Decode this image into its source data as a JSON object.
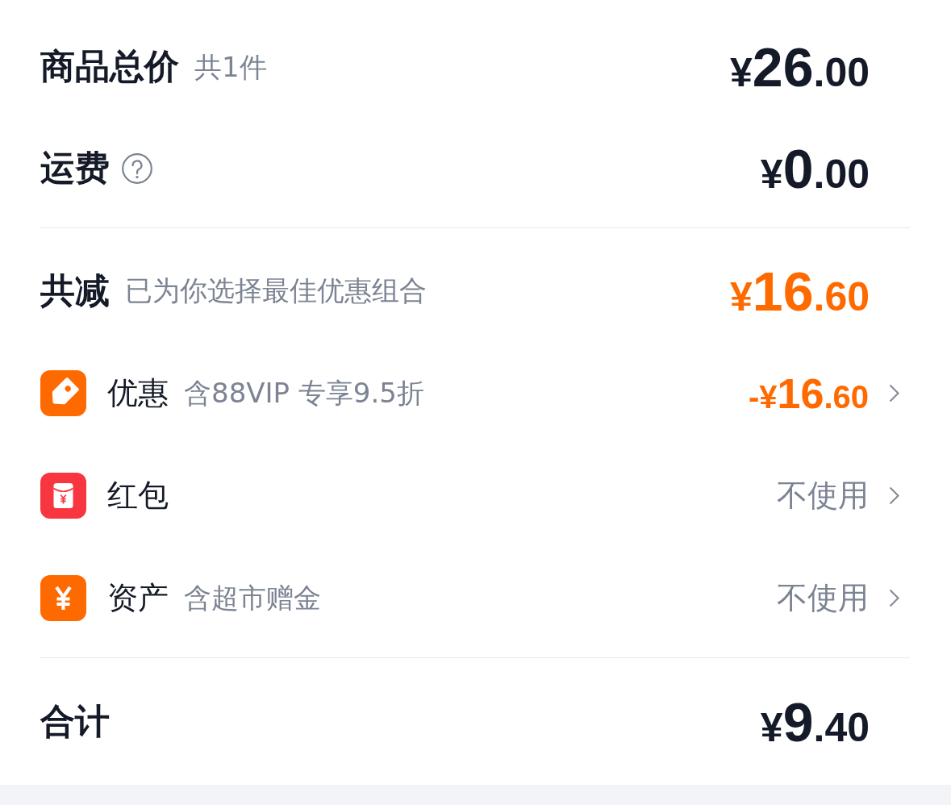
{
  "summary": [
    {
      "label": "商品总价",
      "note": "共1件",
      "help_icon": false,
      "amount": "¥26.00"
    },
    {
      "label": "运费",
      "help_icon": true,
      "amount": "¥0.00"
    }
  ],
  "discount_total": {
    "label": "共减",
    "note": "已为你选择最佳优惠组合",
    "amount": "¥16.60"
  },
  "discounts": [
    {
      "label": "优惠",
      "note": "含88VIP 专享9.5折",
      "kind": "amount",
      "value": "-¥16.60"
    },
    {
      "label": "红包",
      "kind": "option",
      "value": "不使用"
    },
    {
      "label": "资产",
      "note": "含超市赠金",
      "kind": "option",
      "value": "不使用"
    }
  ],
  "total": {
    "label": "合计",
    "amount": "¥9.40"
  }
}
